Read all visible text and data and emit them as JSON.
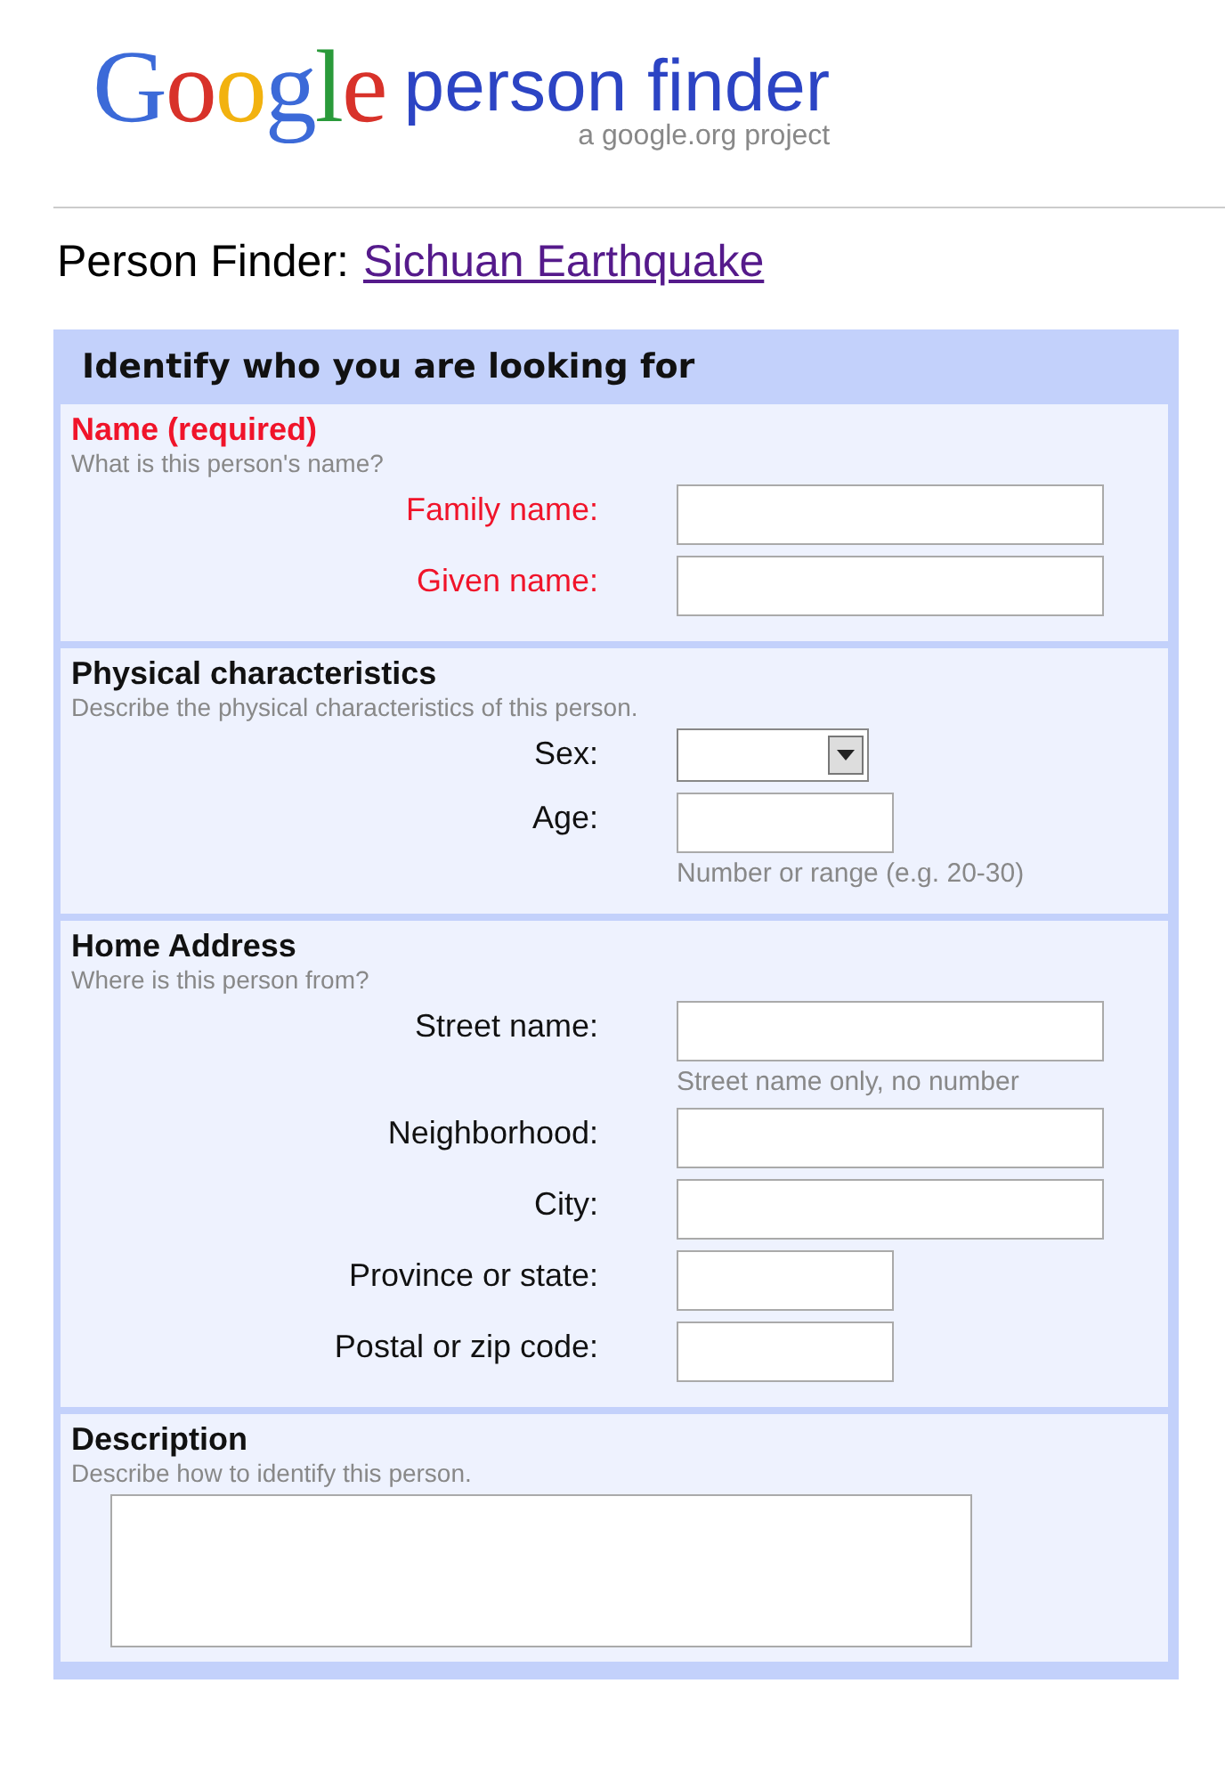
{
  "logo": {
    "letters": [
      {
        "text": "G",
        "color": "#3c6ad8"
      },
      {
        "text": "o",
        "color": "#d8322a"
      },
      {
        "text": "o",
        "color": "#f2b20f"
      },
      {
        "text": "g",
        "color": "#3c6ad8"
      },
      {
        "text": "l",
        "color": "#2a9a3a"
      },
      {
        "text": "e",
        "color": "#d8322a"
      }
    ],
    "product": "person finder",
    "tagline": "a google.org project"
  },
  "title": {
    "label": "Person Finder:",
    "link": "Sichuan Earthquake"
  },
  "form": {
    "heading": "Identify who you are looking for",
    "sections": [
      {
        "title": "Name (required)",
        "required": true,
        "subtitle": "What is this person's name?",
        "fields": [
          {
            "label": "Family name:",
            "kind": "wide"
          },
          {
            "label": "Given name:",
            "kind": "wide"
          }
        ]
      },
      {
        "title": "Physical characteristics",
        "required": false,
        "subtitle": "Describe the physical characteristics of this person.",
        "fields": [
          {
            "label": "Sex:",
            "kind": "select"
          },
          {
            "label": "Age:",
            "kind": "narrow",
            "hint": "Number or range (e.g. 20-30)"
          }
        ]
      },
      {
        "title": "Home Address",
        "required": false,
        "subtitle": "Where is this person from?",
        "fields": [
          {
            "label": "Street name:",
            "kind": "wide",
            "hint": "Street name only, no number"
          },
          {
            "label": "Neighborhood:",
            "kind": "wide"
          },
          {
            "label": "City:",
            "kind": "wide"
          },
          {
            "label": "Province or state:",
            "kind": "narrow"
          },
          {
            "label": "Postal or zip code:",
            "kind": "narrow"
          }
        ]
      },
      {
        "title": "Description",
        "required": false,
        "subtitle": "Describe how to identify this person.",
        "fields": [
          {
            "kind": "textarea"
          }
        ]
      }
    ]
  }
}
